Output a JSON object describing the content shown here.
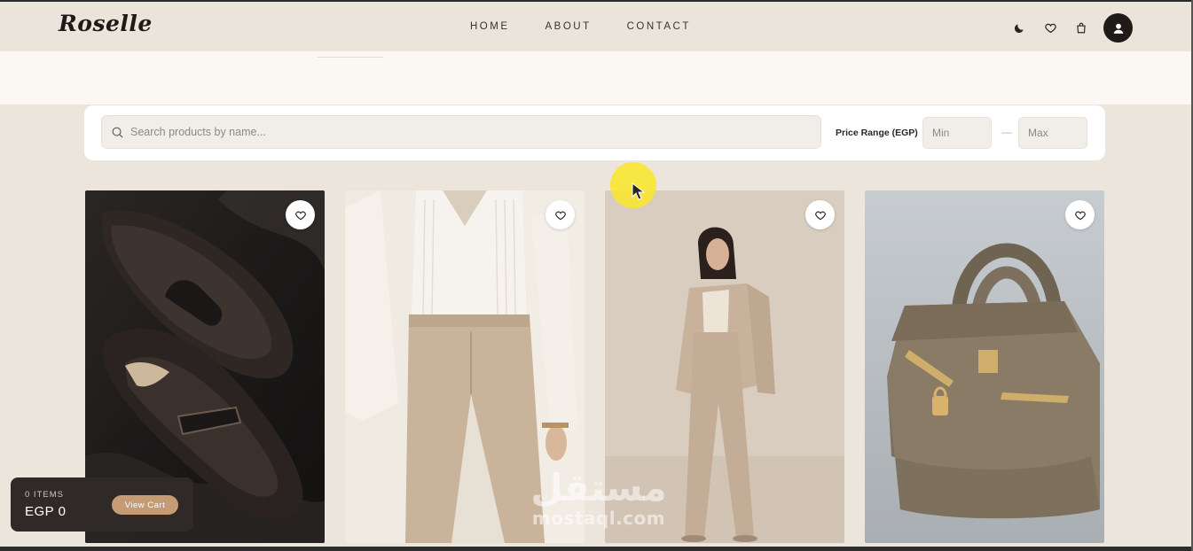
{
  "header": {
    "logo": "Roselle",
    "nav": [
      {
        "label": "HOME"
      },
      {
        "label": "ABOUT"
      },
      {
        "label": "CONTACT"
      }
    ],
    "icons": [
      "moon-icon",
      "heart-icon",
      "shopping-bag-icon",
      "user-icon"
    ]
  },
  "filters": {
    "search_placeholder": "Search products by name...",
    "price_label": "Price Range (EGP)",
    "min_placeholder": "Min",
    "max_placeholder": "Max",
    "separator": "—"
  },
  "products": [
    {
      "image": "brown-leather-loafers"
    },
    {
      "image": "cream-blazer-beige-trousers"
    },
    {
      "image": "woman-beige-suit"
    },
    {
      "image": "taupe-leather-handbag"
    }
  ],
  "cart": {
    "count_label": "0 ITEMS",
    "total": "EGP 0",
    "button_label": "View Cart"
  },
  "watermark": {
    "arabic": "مستقل",
    "latin": "mostaql.com"
  },
  "colors": {
    "page_bg": "#ece5dc",
    "header_bg": "#ebe4db",
    "cart_bg": "#2f2a27",
    "cart_button": "#c49b74",
    "accent_dark": "#1f1b19"
  }
}
